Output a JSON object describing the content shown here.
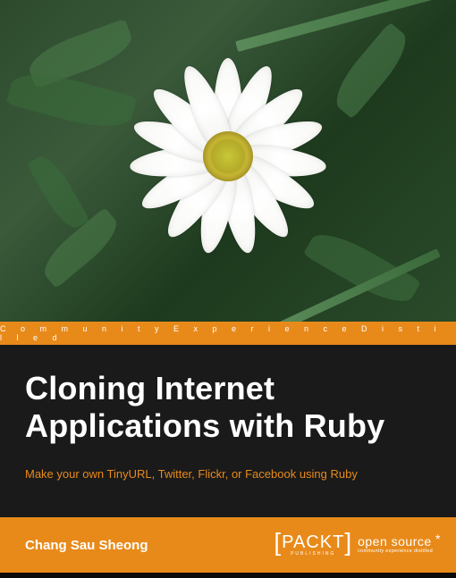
{
  "tagline": "C o m m u n i t y   E x p e r i e n c e   D i s t i l l e d",
  "title_line1": "Cloning Internet",
  "title_line2": "Applications with Ruby",
  "subtitle": "Make your own TinyURL, Twitter, Flickr, or Facebook using Ruby",
  "author": "Chang Sau Sheong",
  "publisher": {
    "name": "PACKT",
    "sub": "PUBLISHING",
    "brand_main": "open source",
    "brand_sub": "community experience distilled"
  }
}
